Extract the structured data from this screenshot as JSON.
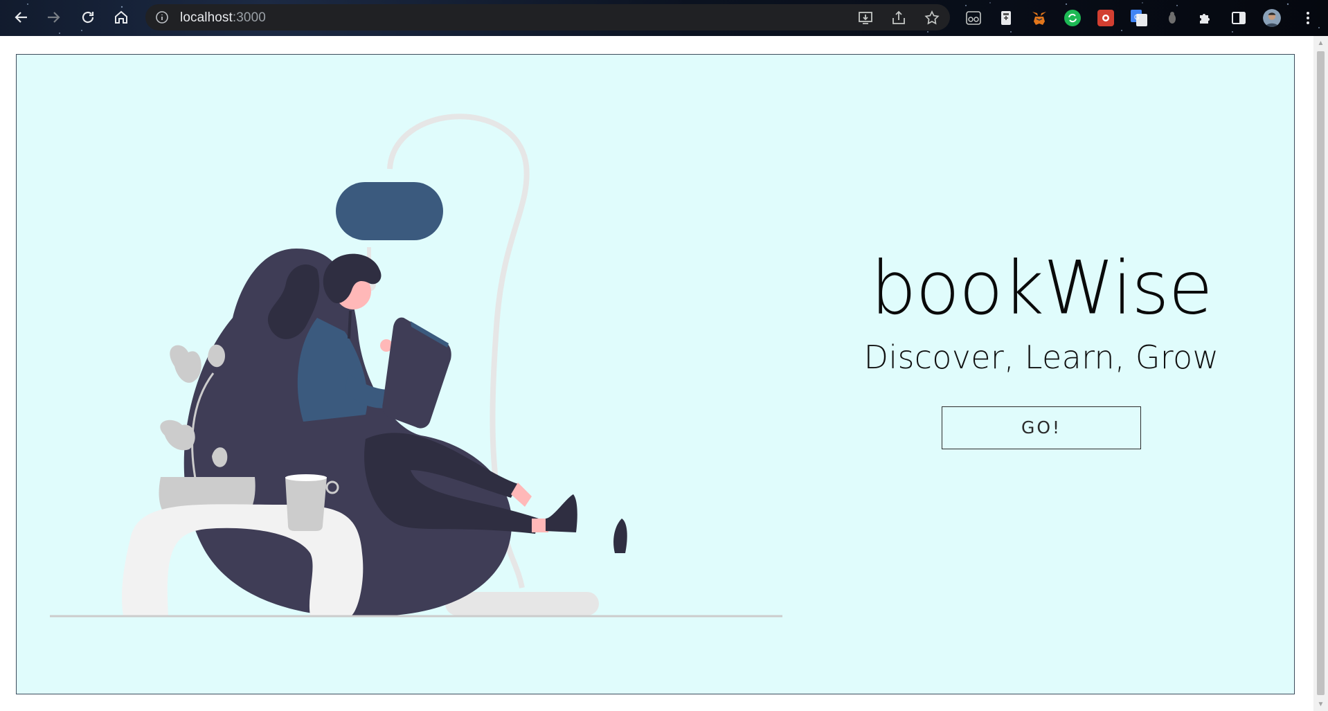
{
  "browser": {
    "url_host": "localhost",
    "url_port": ":3000"
  },
  "hero": {
    "title": "bookWise",
    "tagline": "Discover, Learn, Grow",
    "cta_label": "GO!"
  },
  "colors": {
    "hero_background": "#e0fcfc",
    "lamp_shade": "#3b5a7e",
    "chair": "#3f3d56",
    "floor_line": "#cccccc"
  }
}
